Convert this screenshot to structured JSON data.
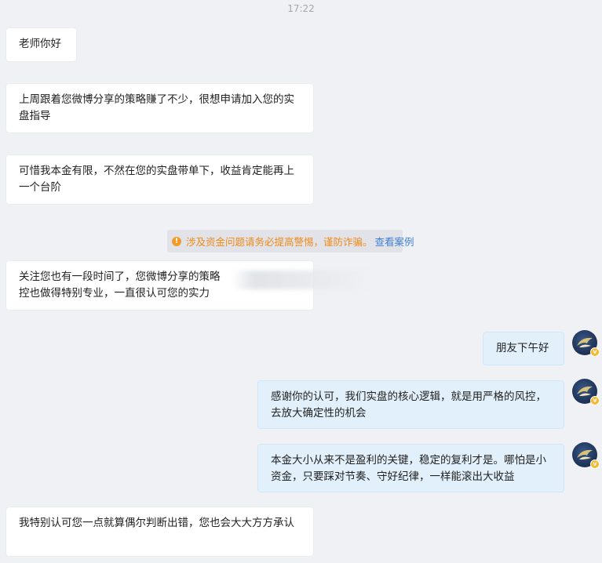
{
  "timestamp": "17:22",
  "messages": {
    "m1": "老师你好",
    "m2": "上周跟着您微博分享的策略赚了不少，很想申请加入您的实盘指导",
    "m3": "可惜我本金有限，不然在您的实盘带单下，收益肯定能再上一个台阶",
    "m4a": "关注您也有一段时间了，您微博分享的策略",
    "m4b": "控也做得特别专业，一直很认可您的实力",
    "m5": "朋友下午好",
    "m6": "感谢你的认可，我们实盘的核心逻辑，就是用严格的风控，去放大确定性的机会",
    "m7": "本金大小从来不是盈利的关键，稳定的复利才是。哪怕是小资金，只要踩对节奏、守好纪律，一样能滚出大收益",
    "m8": "我特别认可您一点就算偶尔判断出错，您也会大大方方承认"
  },
  "notice": {
    "icon": "!",
    "text": "涉及资金问题请务必提高警惕，谨防诈骗。",
    "link": "查看案例"
  },
  "avatar": {
    "badge": "v",
    "badge_color": "#f5b82e"
  },
  "colors": {
    "incoming_bubble": "#ffffff",
    "outgoing_bubble": "#e2f0fb",
    "warning": "#f08a19",
    "link": "#3f7fd6"
  }
}
